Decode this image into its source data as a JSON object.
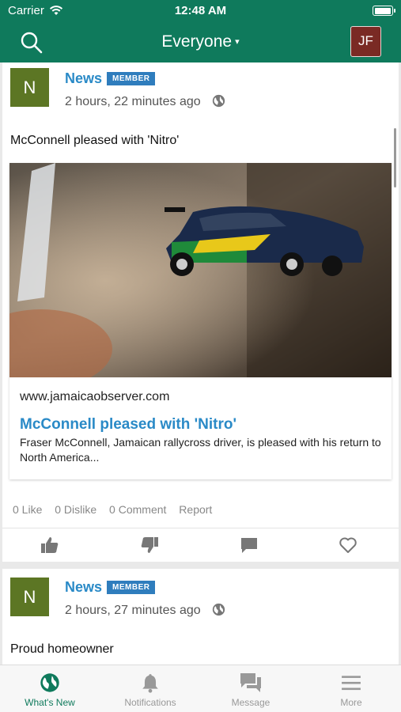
{
  "status_bar": {
    "carrier": "Carrier",
    "time": "12:48 AM"
  },
  "nav": {
    "title": "Everyone",
    "caret": "▾",
    "avatar_initials": "JF"
  },
  "colors": {
    "brand": "#0f7a5c",
    "link": "#2a8ac7",
    "badge": "#2f7dbd"
  },
  "posts": [
    {
      "avatar_letter": "N",
      "poster": "News",
      "badge": "MEMBER",
      "time_ago": "2 hours, 22 minutes ago",
      "text": "McConnell pleased with 'Nitro'",
      "link": {
        "domain": "www.jamaicaobserver.com",
        "title": "McConnell pleased with 'Nitro'",
        "description": "Fraser McConnell, Jamaican rallycross driver, is pleased with his return to North America..."
      },
      "stats": {
        "likes": "0 Like",
        "dislikes": "0 Dislike",
        "comments": "0 Comment",
        "report": "Report"
      }
    },
    {
      "avatar_letter": "N",
      "poster": "News",
      "badge": "MEMBER",
      "time_ago": "2 hours, 27 minutes ago",
      "text": "Proud homeowner"
    }
  ],
  "tabs": [
    {
      "label": "What's New",
      "icon": "globe-icon",
      "active": true
    },
    {
      "label": "Notifications",
      "icon": "bell-icon"
    },
    {
      "label": "Message",
      "icon": "chat-icon"
    },
    {
      "label": "More",
      "icon": "menu-icon"
    }
  ]
}
